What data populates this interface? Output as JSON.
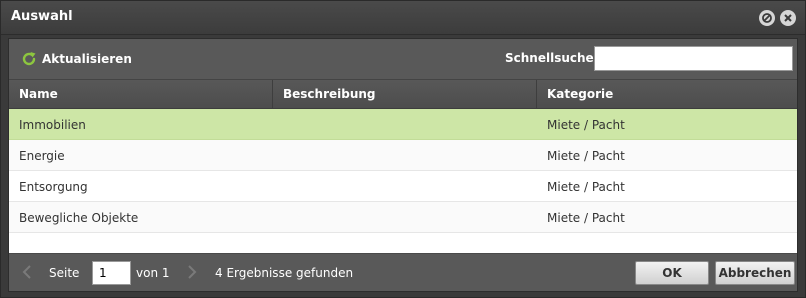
{
  "window": {
    "title": "Auswahl",
    "min_icon": "minimize-icon",
    "close_icon": "close-icon"
  },
  "toolbar": {
    "refresh_label": "Aktualisieren",
    "refresh_icon": "refresh-icon",
    "search_label": "Schnellsuche",
    "search_value": "",
    "accent_color": "#8dc63f"
  },
  "table": {
    "columns": [
      "Name",
      "Beschreibung",
      "Kategorie"
    ],
    "rows": [
      {
        "name": "Immobilien",
        "description": "",
        "category": "Miete / Pacht",
        "selected": true
      },
      {
        "name": "Energie",
        "description": "",
        "category": "Miete / Pacht",
        "selected": false
      },
      {
        "name": "Entsorgung",
        "description": "",
        "category": "Miete / Pacht",
        "selected": false
      },
      {
        "name": "Bewegliche Objekte",
        "description": "",
        "category": "Miete / Pacht",
        "selected": false
      }
    ],
    "selected_color": "#cde6a6"
  },
  "pager": {
    "page_label": "Seite",
    "page_value": "1",
    "of_label": "von 1",
    "results_text": "4 Ergebnisse gefunden"
  },
  "buttons": {
    "ok": "OK",
    "cancel": "Abbrechen"
  }
}
